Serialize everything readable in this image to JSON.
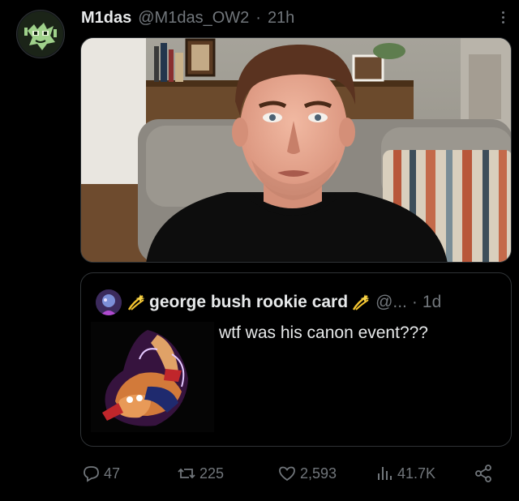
{
  "post": {
    "display_name": "M1das",
    "handle": "@M1das_OW2",
    "separator": "·",
    "time": "21h",
    "more_icon": "more-vertical-icon"
  },
  "quote": {
    "display_name": "george bush rookie card",
    "handle": "@...",
    "separator": "·",
    "time": "1d",
    "text": "wtf was his canon event???"
  },
  "actions": {
    "replies": "47",
    "reposts": "225",
    "likes": "2,593",
    "views": "41.7K"
  },
  "colors": {
    "background": "#000000",
    "text": "#e7e9ea",
    "muted": "#71767b",
    "border": "#2f3336",
    "emoji_gold": "#f4c430"
  }
}
